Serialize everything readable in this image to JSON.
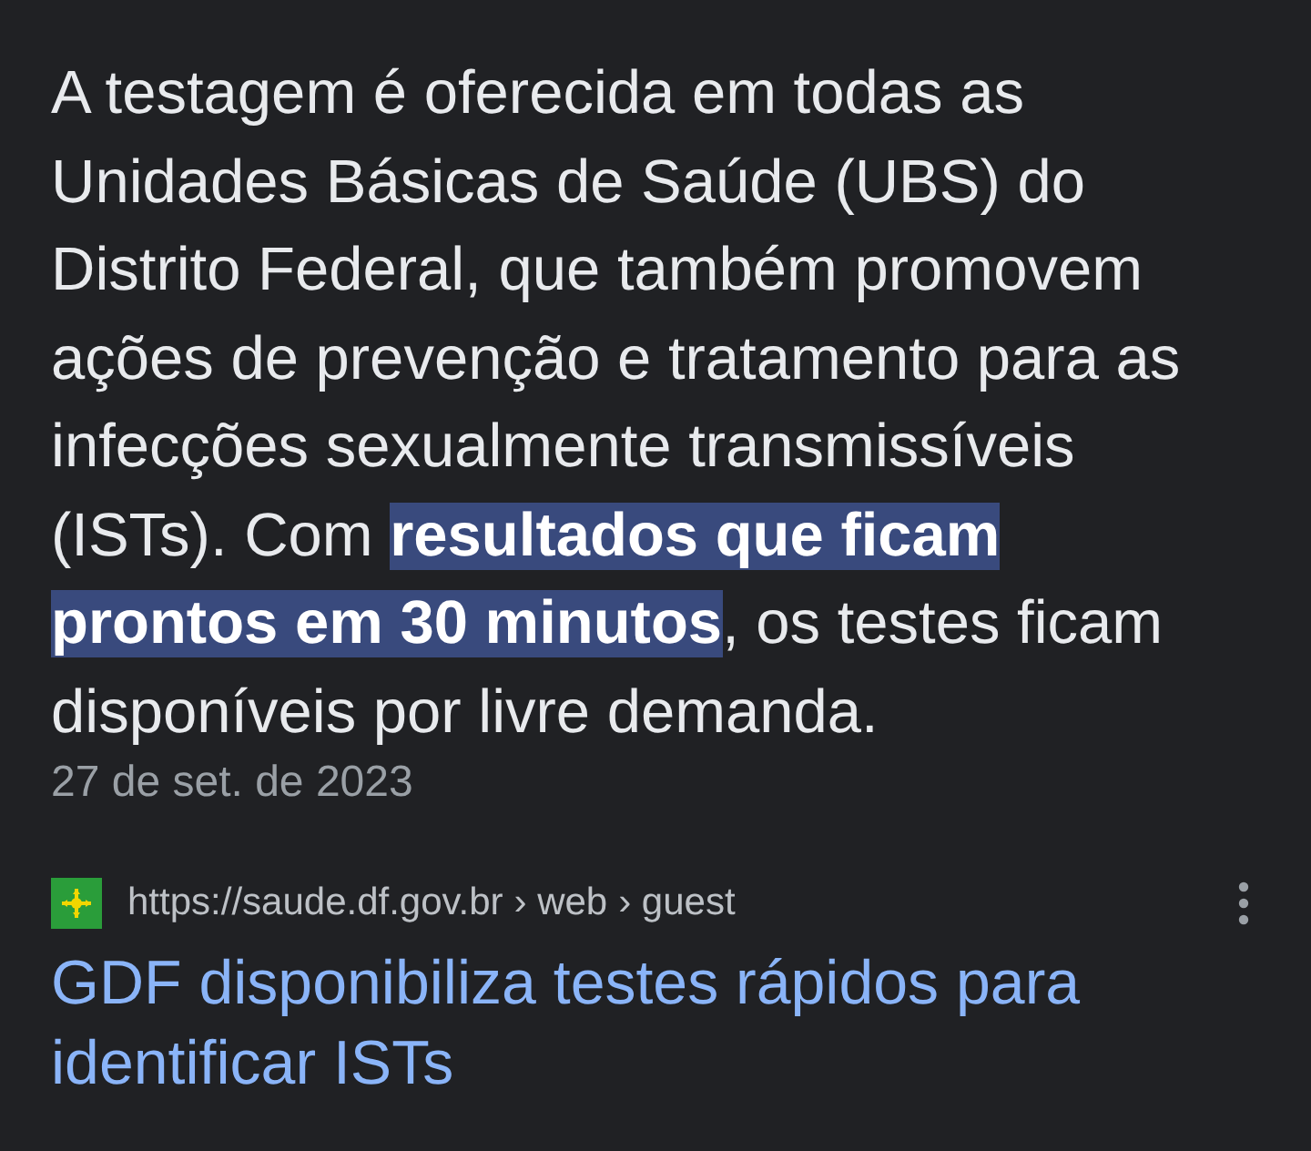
{
  "snippet": {
    "segments": [
      {
        "text": "A testagem é oferecida em todas as Unidades Básicas de Saúde (UBS) do Distrito Federal, que também promovem ações de prevenção e tratamento para as infecções sexualmente transmissíveis (ISTs). Com ",
        "highlighted": false
      },
      {
        "text": "resultados que ficam prontos em 30 minutos",
        "highlighted": true
      },
      {
        "text": ", os testes ficam disponíveis por livre demanda.",
        "highlighted": false
      }
    ],
    "date": "27 de set. de 2023"
  },
  "result": {
    "url": "https://saude.df.gov.br",
    "breadcrumbs": [
      "› web",
      "› guest"
    ],
    "title": "GDF disponibiliza testes rápidos para identificar ISTs"
  }
}
